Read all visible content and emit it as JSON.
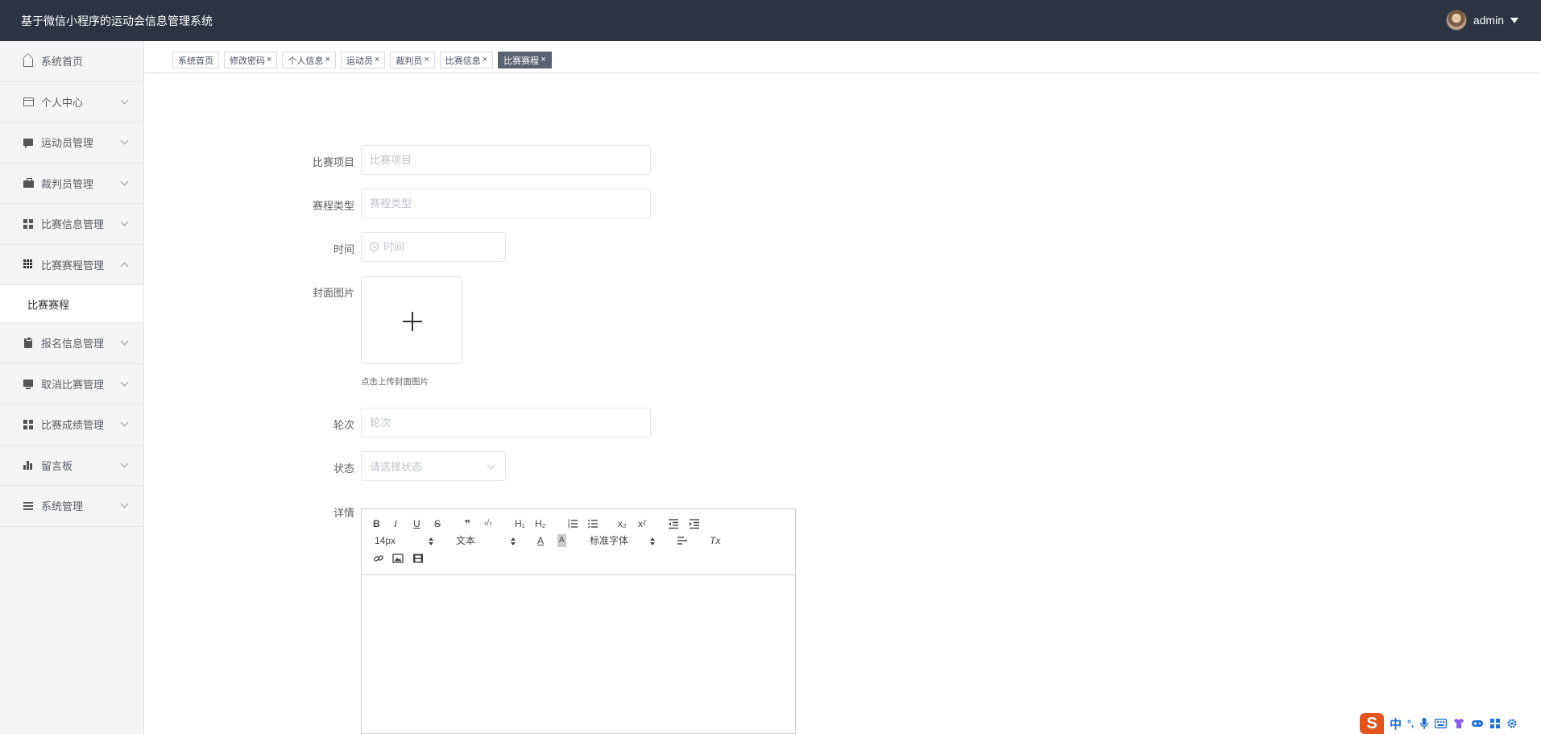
{
  "header": {
    "app_title": "基于微信小程序的运动会信息管理系统",
    "username": "admin"
  },
  "sidebar": {
    "items": [
      {
        "label": "系统首页",
        "icon": "home-icon"
      },
      {
        "label": "个人中心",
        "icon": "card-icon"
      },
      {
        "label": "运动员管理",
        "icon": "chat-icon"
      },
      {
        "label": "裁判员管理",
        "icon": "briefcase-icon"
      },
      {
        "label": "比赛信息管理",
        "icon": "grid-icon"
      },
      {
        "label": "比赛赛程管理",
        "icon": "apps-icon",
        "expanded": true
      },
      {
        "label": "比赛赛程",
        "icon": "",
        "sub": true
      },
      {
        "label": "报名信息管理",
        "icon": "clipboard-icon"
      },
      {
        "label": "取消比赛管理",
        "icon": "monitor-icon"
      },
      {
        "label": "比赛成绩管理",
        "icon": "grid-icon"
      },
      {
        "label": "留言板",
        "icon": "bar-chart-icon"
      },
      {
        "label": "系统管理",
        "icon": "menu-icon"
      }
    ]
  },
  "tabs": [
    {
      "label": "系统首页",
      "closable": false
    },
    {
      "label": "修改密码",
      "closable": true
    },
    {
      "label": "个人信息",
      "closable": true
    },
    {
      "label": "运动员",
      "closable": true
    },
    {
      "label": "裁判员",
      "closable": true
    },
    {
      "label": "比赛信息",
      "closable": true
    },
    {
      "label": "比赛赛程",
      "closable": true,
      "active": true
    }
  ],
  "tab_close_glyph": "×",
  "form": {
    "project": {
      "label": "比赛项目",
      "placeholder": "比赛项目"
    },
    "schedule_type": {
      "label": "赛程类型",
      "placeholder": "赛程类型"
    },
    "time": {
      "label": "时间",
      "placeholder": "时间"
    },
    "cover": {
      "label": "封面图片",
      "tip": "点击上传封面图片"
    },
    "round": {
      "label": "轮次",
      "placeholder": "轮次"
    },
    "status": {
      "label": "状态",
      "placeholder": "请选择状态"
    },
    "details": {
      "label": "详情"
    }
  },
  "editor": {
    "font_size": "14px",
    "header_select": "文本",
    "font_family": "标准字体",
    "buttons": {
      "bold": "B",
      "italic": "I",
      "underline": "U",
      "strike": "S",
      "quote": "❞",
      "code": "‹/›",
      "h1": "H₁",
      "h2": "H₂",
      "sub": "x₂",
      "sup": "x²",
      "color": "A",
      "background": "A",
      "clean": "Tx"
    }
  },
  "ime": {
    "logo": "S",
    "mode": "中",
    "punct": "°,"
  },
  "colors": {
    "header_bg": "#2b3440",
    "sidebar_bg": "#f5f5f5",
    "active_tab": "#5a6270",
    "ime_logo": "#e4551e"
  }
}
